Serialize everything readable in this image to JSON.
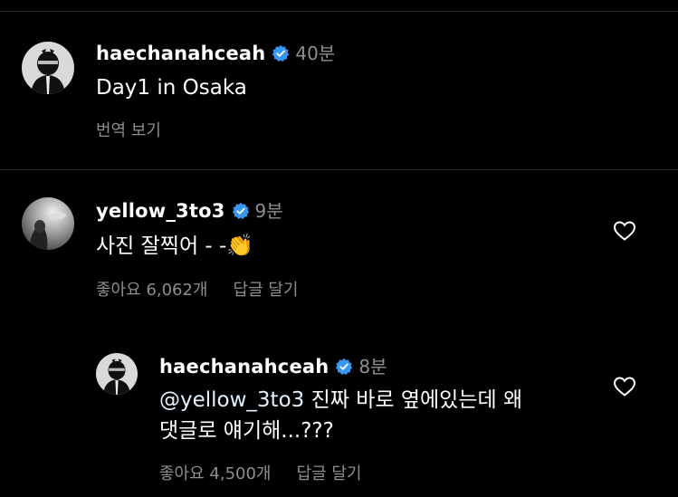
{
  "post": {
    "username": "haechanahceah",
    "time": "40분",
    "caption": "Day1 in Osaka",
    "translate_label": "번역 보기"
  },
  "comment1": {
    "username": "yellow_3to3",
    "time": "9분",
    "text": "사진 잘찍어 - -",
    "emoji": "👏",
    "likes_label": "좋아요 6,062개",
    "reply_label": "답글 달기"
  },
  "reply1": {
    "username": "haechanahceah",
    "time": "8분",
    "mention": "@yellow_3to3",
    "text_line1": " 진짜 바로 옆에있는데 왜",
    "text_line2": "댓글로 얘기해...???",
    "likes_label": "좋아요 4,500개",
    "reply_label": "답글 달기"
  },
  "colors": {
    "background": "#000000",
    "text": "#ffffff",
    "muted": "#8e8e8e",
    "verified": "#3897f0",
    "divider": "#262626"
  }
}
